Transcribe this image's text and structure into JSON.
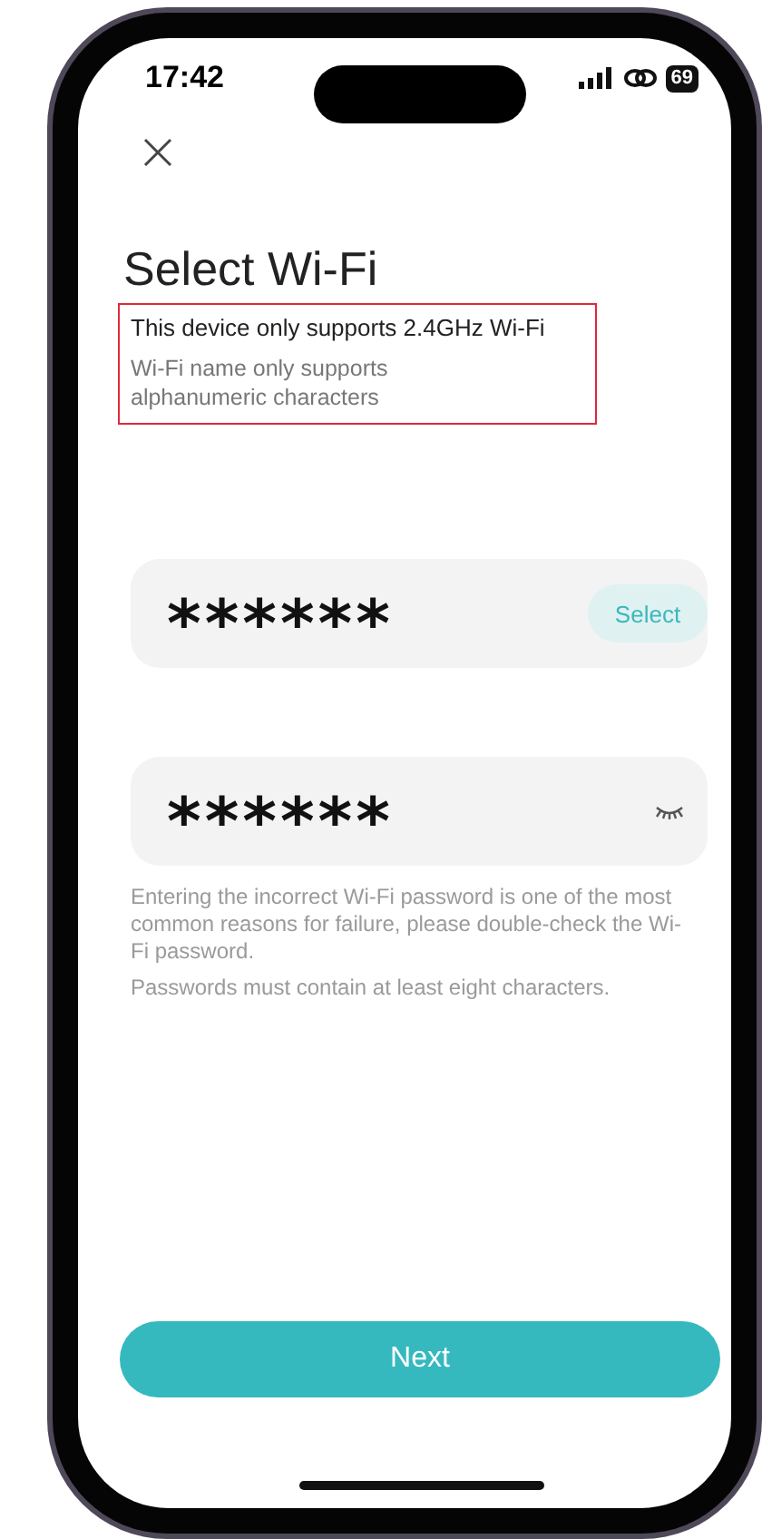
{
  "status_bar": {
    "time": "17:42",
    "battery": "69"
  },
  "title": "Select Wi-Fi",
  "notices": [
    "This device only supports 2.4GHz Wi-Fi",
    "Wi-Fi name only supports alphanumeric characters"
  ],
  "wifi_field": {
    "value": "******",
    "button": "Select"
  },
  "password_field": {
    "value": "******",
    "visible": false
  },
  "hints": [
    "Entering the incorrect Wi-Fi password is one of the most common reasons for failure, please double-check the Wi-Fi password.",
    "Passwords must contain at least eight characters."
  ],
  "next_button": "Next"
}
